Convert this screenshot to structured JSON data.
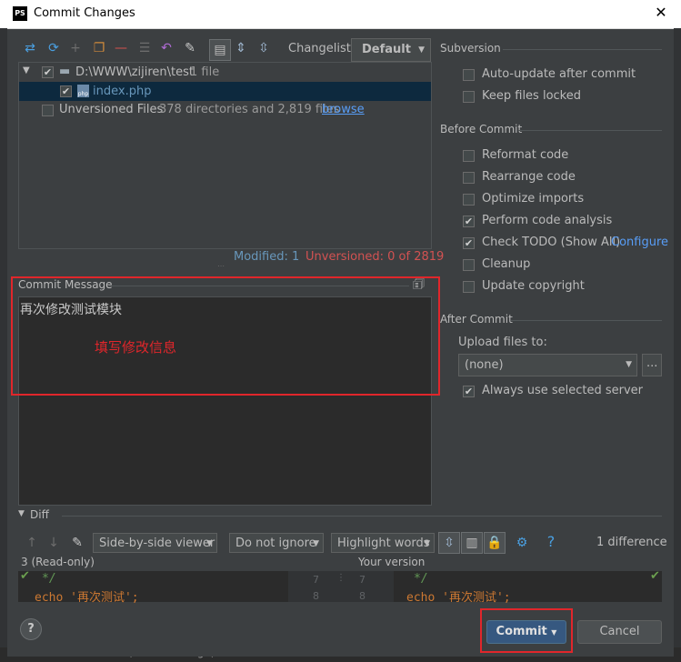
{
  "window": {
    "title": "Commit Changes",
    "app_logo": "PS"
  },
  "toolbar": {
    "changelist_label": "Changelist:",
    "changelist_value": "Default",
    "icons": [
      "diff-icon",
      "refresh-icon",
      "add-icon",
      "move-icon",
      "remove-icon",
      "group-icon",
      "rollback-icon",
      "edit-icon",
      "show-directories-icon",
      "expand-all-icon",
      "collapse-all-icon"
    ]
  },
  "tree": {
    "root_path": "D:\\WWW\\zijiren\\test",
    "root_count": "1 file",
    "file_name": "index.php",
    "unversioned_label": "Unversioned Files",
    "unversioned_count": "378 directories and 2,819 files",
    "browse_link": "browse"
  },
  "status": {
    "modified": "Modified: 1",
    "unversioned": "Unversioned: 0 of 2819"
  },
  "commit_message": {
    "title": "Commit Message",
    "value": "再次修改测试模块",
    "annotation": "填写修改信息"
  },
  "subversion": {
    "title": "Subversion",
    "options": [
      {
        "label": "Auto-update after commit",
        "checked": false
      },
      {
        "label": "Keep files locked",
        "checked": false
      }
    ]
  },
  "before_commit": {
    "title": "Before Commit",
    "options": [
      {
        "label": "Reformat code",
        "checked": false
      },
      {
        "label": "Rearrange code",
        "checked": false
      },
      {
        "label": "Optimize imports",
        "checked": false
      },
      {
        "label": "Perform code analysis",
        "checked": true
      },
      {
        "label": "Check TODO (Show All)",
        "checked": true
      },
      {
        "label": "Cleanup",
        "checked": false
      },
      {
        "label": "Update copyright",
        "checked": false
      }
    ],
    "configure_link": "Configure"
  },
  "after_commit": {
    "title": "After Commit",
    "upload_label": "Upload files to:",
    "upload_value": "(none)",
    "browse_button": "...",
    "always_use": {
      "label": "Always use selected server",
      "checked": true
    }
  },
  "diff": {
    "title": "Diff",
    "viewer": "Side-by-side viewer",
    "whitespace": "Do not ignore",
    "highlight": "Highlight words",
    "count": "1 difference",
    "left_title": "3 (Read-only)",
    "right_title": "Your version",
    "left_lines": [
      "*/",
      "echo '再次测试';"
    ],
    "line_numbers_left": [
      "7",
      "8"
    ],
    "line_numbers_right": [
      "7",
      "8"
    ],
    "right_lines": [
      "*/",
      "echo '再次测试';"
    ]
  },
  "buttons": {
    "commit": "Commit",
    "cancel": "Cancel",
    "help": "?"
  },
  "background": {
    "bottom_text": "Committed revision 8 (5 minutes ago)"
  },
  "colors": {
    "accent_link": "#589df6",
    "annotation_red": "#e0262b",
    "unversioned_red": "#d25252",
    "selected_row": "#0d293e"
  }
}
